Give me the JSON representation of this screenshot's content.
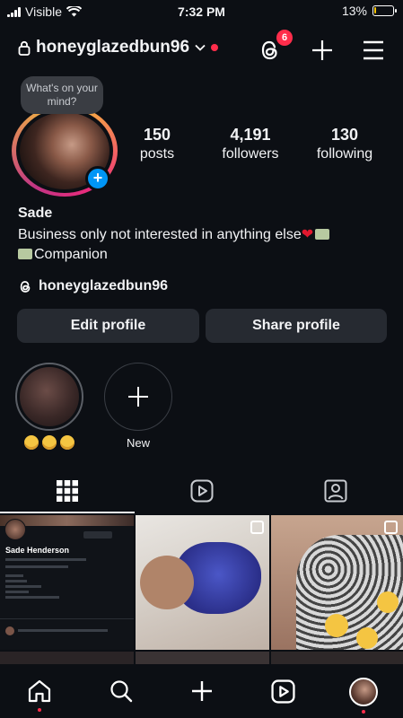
{
  "status_bar": {
    "carrier": "Visible",
    "time": "7:32 PM",
    "battery": "13%",
    "battery_level": 0.13,
    "battery_color": "#f5c400"
  },
  "header": {
    "username": "honeyglazedbun96",
    "threads_badge": "6",
    "icons": [
      "lock-icon",
      "chevron-down-icon",
      "threads-icon",
      "plus-icon",
      "menu-icon"
    ]
  },
  "profile": {
    "note": "What's on your mind?",
    "stats": [
      {
        "value": "150",
        "label": "posts"
      },
      {
        "value": "4,191",
        "label": "followers"
      },
      {
        "value": "130",
        "label": "following"
      }
    ],
    "name": "Sade",
    "bio_line1": "Business only not interested in anything else",
    "bio_line2": "Companion",
    "threads_handle": "honeyglazedbun96"
  },
  "buttons": {
    "edit": "Edit profile",
    "share": "Share profile"
  },
  "highlights": {
    "new_label": "New"
  },
  "tabs": [
    "grid-icon",
    "reels-icon",
    "tagged-icon"
  ],
  "grid": {
    "mini_profile_name": "Sade Henderson"
  },
  "nav": [
    "home-icon",
    "search-icon",
    "create-icon",
    "reels-icon",
    "profile-avatar"
  ],
  "colors": {
    "accent": "#0095f6",
    "badge": "#ff2d4b",
    "background": "#0c0f14",
    "button": "#262a31"
  }
}
